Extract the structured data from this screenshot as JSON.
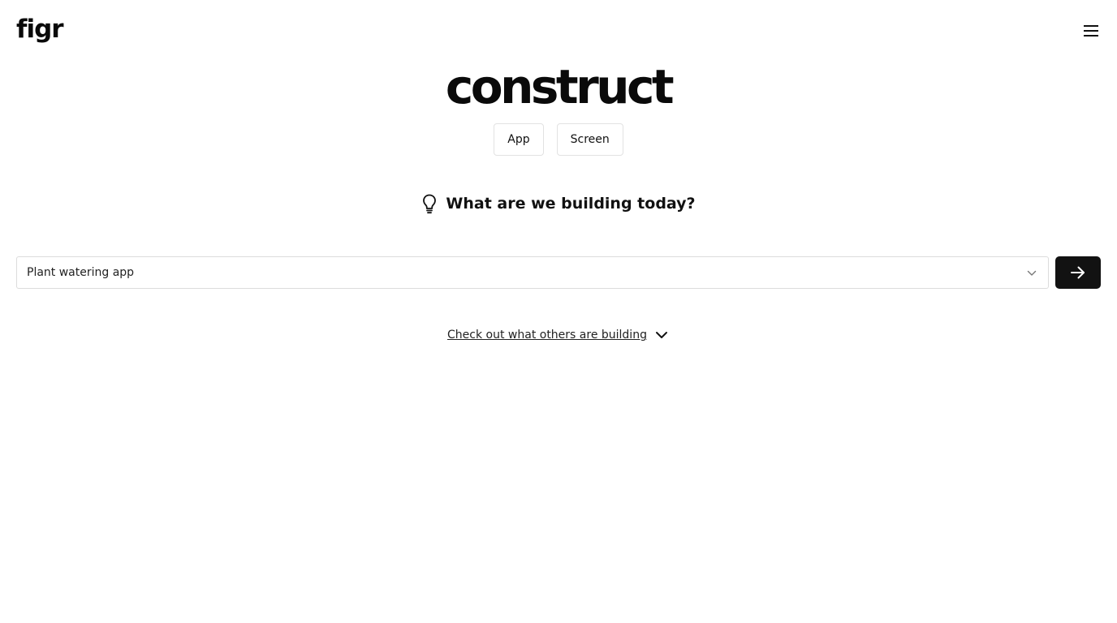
{
  "header": {
    "logo": "figr",
    "menu_icon": "hamburger-menu-icon"
  },
  "hero": {
    "title": "construct"
  },
  "mode_tabs": [
    {
      "label": "App"
    },
    {
      "label": "Screen"
    }
  ],
  "prompt": {
    "icon": "lightbulb-icon",
    "heading": "What are we building today?",
    "input_value": "Plant watering app",
    "dropdown_icon": "chevron-down-icon",
    "submit_icon": "arrow-right-icon"
  },
  "explore": {
    "link_text": "Check out what others are building",
    "icon": "chevron-down-icon"
  },
  "colors": {
    "background": "#ffffff",
    "text": "#111111",
    "submit_bg": "#121212",
    "border": "#dcdcdc"
  }
}
